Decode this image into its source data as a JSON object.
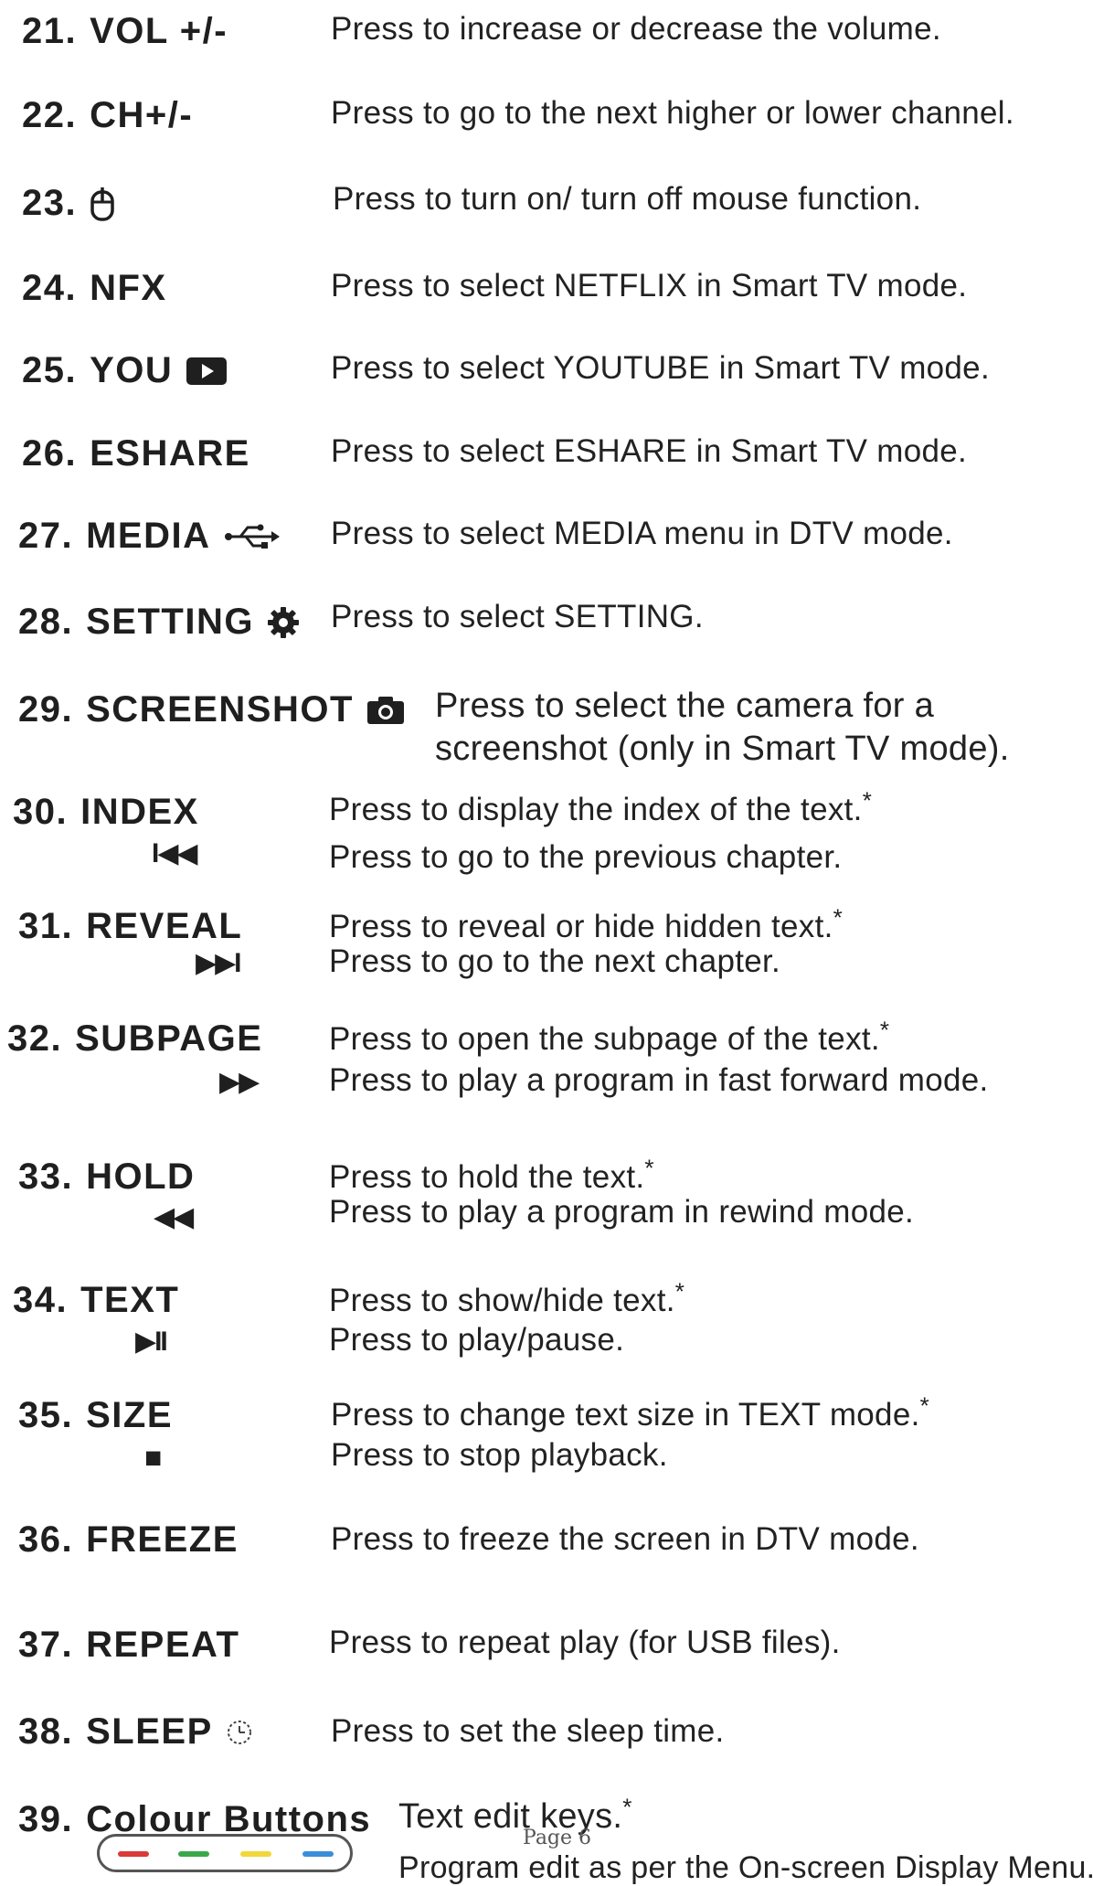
{
  "items": [
    {
      "num": "21.",
      "key": "VOL  +/-",
      "desc": "Press to increase or decrease the volume."
    },
    {
      "num": "22.",
      "key": "CH+/-",
      "desc": "Press to go to the next higher or lower channel."
    },
    {
      "num": "23.",
      "key": "",
      "icon": "mouse-icon",
      "desc": "Press to turn on/ turn off mouse function."
    },
    {
      "num": "24.",
      "key": "NFX",
      "desc": "Press to select NETFLIX in Smart TV mode."
    },
    {
      "num": "25.",
      "key": "YOU",
      "icon": "youtube-play-icon",
      "desc": "Press to select YOUTUBE in Smart TV mode."
    },
    {
      "num": "26.",
      "key": "ESHARE",
      "desc": "Press to select ESHARE  in Smart TV mode."
    },
    {
      "num": "27.",
      "key": "MEDIA",
      "icon": "usb-icon",
      "desc": "Press to select MEDIA menu in DTV mode."
    },
    {
      "num": "28.",
      "key": "SETTING",
      "icon": "gear-icon",
      "desc": "Press to select SETTING."
    },
    {
      "num": "29.",
      "key": "SCREENSHOT",
      "icon": "camera-icon",
      "desc": "Press to select the camera for a",
      "desc2": "screenshot (only in Smart TV mode)."
    },
    {
      "num": "30.",
      "key": "INDEX",
      "symbol": "I◀◀",
      "desc": "Press to display the index of the text.",
      "desc2": "Press to go to the previous chapter."
    },
    {
      "num": "31.",
      "key": "REVEAL",
      "symbol": "▶▶I",
      "desc": "Press to reveal or hide hidden text.",
      "desc2": "Press to go to the next chapter."
    },
    {
      "num": "32.",
      "key": "SUBPAGE",
      "symbol": "▶▶",
      "desc": "Press to open the subpage of the text.",
      "desc2": "Press to play a program in fast forward mode."
    },
    {
      "num": "33.",
      "key": "HOLD",
      "symbol": "◀◀",
      "desc": "Press to hold the text.",
      "desc2": "Press to play a program in rewind mode."
    },
    {
      "num": "34.",
      "key": "TEXT",
      "symbol": "▶II",
      "desc": "Press to show/hide text.",
      "desc2": "Press to play/pause."
    },
    {
      "num": "35.",
      "key": "SIZE",
      "symbol": "■",
      "desc": "Press to change text size in TEXT mode.",
      "desc2": "Press to stop playback."
    },
    {
      "num": "36.",
      "key": "FREEZE",
      "desc": "Press to  freeze the screen in  DTV mode."
    },
    {
      "num": "37.",
      "key": "REPEAT",
      "desc": "Press to repeat play (for USB files)."
    },
    {
      "num": "38.",
      "key": "SLEEP",
      "icon": "clock-icon",
      "desc": "Press to set  the sleep time."
    },
    {
      "num": "39.",
      "key": "Colour Buttons",
      "desc": "Text edit keys.",
      "desc2": "Program edit  as per the On-screen Display Menu."
    }
  ],
  "footnote_mark": "*",
  "page_number": "Page 6",
  "colour_buttons": [
    "#d93a3a",
    "#3aa84a",
    "#f2d63a",
    "#3a8fd9"
  ]
}
